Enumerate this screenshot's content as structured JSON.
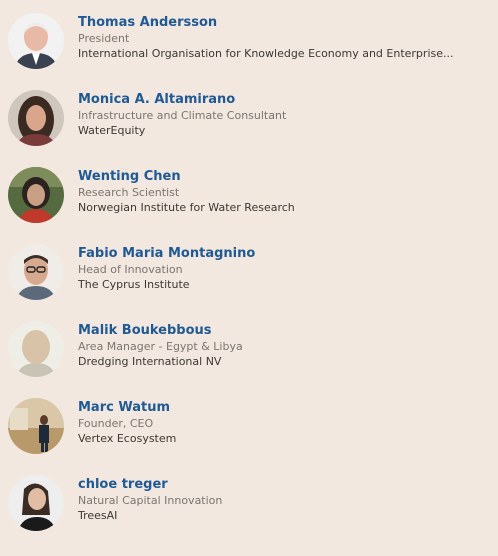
{
  "people": [
    {
      "name": "Thomas Andersson",
      "role": "President",
      "org": "International Organisation for Knowledge Economy and Enterprise...",
      "avatar": "portrait-photo"
    },
    {
      "name": "Monica A. Altamirano",
      "role": "Infrastructure and Climate Consultant",
      "org": "WaterEquity",
      "avatar": "portrait-photo"
    },
    {
      "name": "Wenting Chen",
      "role": "Research Scientist",
      "org": "Norwegian Institute for Water Research",
      "avatar": "portrait-photo"
    },
    {
      "name": "Fabio Maria Montagnino",
      "role": "Head of Innovation",
      "org": "The Cyprus Institute",
      "avatar": "portrait-photo"
    },
    {
      "name": "Malik Boukebbous",
      "role": "Area Manager - Egypt & Libya",
      "org": "Dredging International NV",
      "avatar": "portrait-photo"
    },
    {
      "name": "Marc Watum",
      "role": "Founder, CEO",
      "org": "Vertex Ecosystem",
      "avatar": "portrait-photo"
    },
    {
      "name": "chloe treger",
      "role": "Natural Capital Innovation",
      "org": "TreesAI",
      "avatar": "portrait-photo"
    }
  ]
}
